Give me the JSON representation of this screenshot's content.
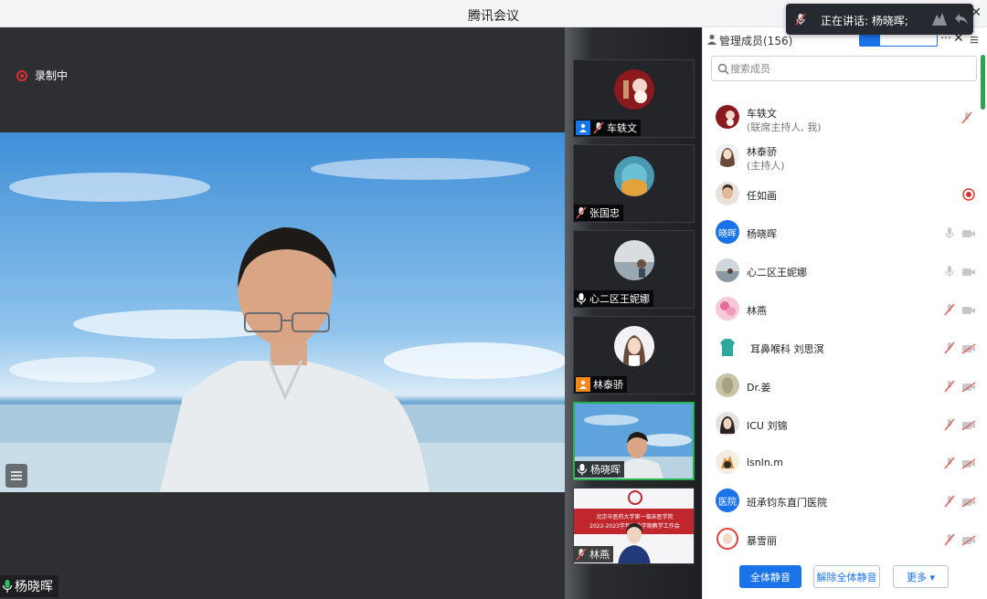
{
  "app": {
    "title": "腾讯会议"
  },
  "speaking": {
    "text": "正在讲话: 杨晓晖;"
  },
  "recording": {
    "label": "录制中"
  },
  "main_video": {
    "name": "杨晓晖"
  },
  "thumbnails": [
    {
      "name": "车轶文",
      "badge": "host",
      "mic": "muted"
    },
    {
      "name": "张国忠",
      "badge": "none",
      "mic": "muted"
    },
    {
      "name": "心二区王妮娜",
      "badge": "none",
      "mic": "on"
    },
    {
      "name": "林泰骄",
      "badge": "cohost",
      "mic": "none"
    },
    {
      "name": "杨晓晖",
      "badge": "none",
      "mic": "on",
      "active": true
    },
    {
      "name": "林燕",
      "badge": "none",
      "mic": "muted",
      "banner": {
        "line1": "北京中医药大学第一临床医学院",
        "line2": "2022-2023学年秋季学期教学工作会"
      }
    }
  ],
  "panel": {
    "title": "管理成员(156)",
    "search_placeholder": "搜索成员",
    "members": [
      {
        "name": "车轶文",
        "role": "(联席主持人, 我)",
        "status": "muted"
      },
      {
        "name": "林泰骄",
        "role": "(主持人)",
        "status": "none"
      },
      {
        "name": "任如画",
        "role": "",
        "status": "recording"
      },
      {
        "name": "杨晓晖",
        "role": "",
        "status": "mic-cam",
        "avatar_text": "晓晖"
      },
      {
        "name": "心二区王妮娜",
        "role": "",
        "status": "mic-cam"
      },
      {
        "name": "林燕",
        "role": "",
        "status": "muted-cam"
      },
      {
        "name": "耳鼻喉科 刘思溟",
        "role": "",
        "status": "muted-camoff"
      },
      {
        "name": "Dr.姜",
        "role": "",
        "status": "muted-camoff"
      },
      {
        "name": "ICU 刘锦",
        "role": "",
        "status": "muted-camoff"
      },
      {
        "name": "lsnln.m",
        "role": "",
        "status": "muted-camoff"
      },
      {
        "name": "班承钧东直门医院",
        "role": "",
        "status": "muted-camoff",
        "avatar_text": "医院"
      },
      {
        "name": "暴雪丽",
        "role": "",
        "status": "muted-camoff"
      }
    ],
    "footer": {
      "mute_all": "全体静音",
      "unmute_all": "解除全体静音",
      "more": "更多 ▾"
    }
  },
  "colors": {
    "accent": "#1a73e8",
    "recording": "#d9302e",
    "active_border": "#27b34f"
  }
}
